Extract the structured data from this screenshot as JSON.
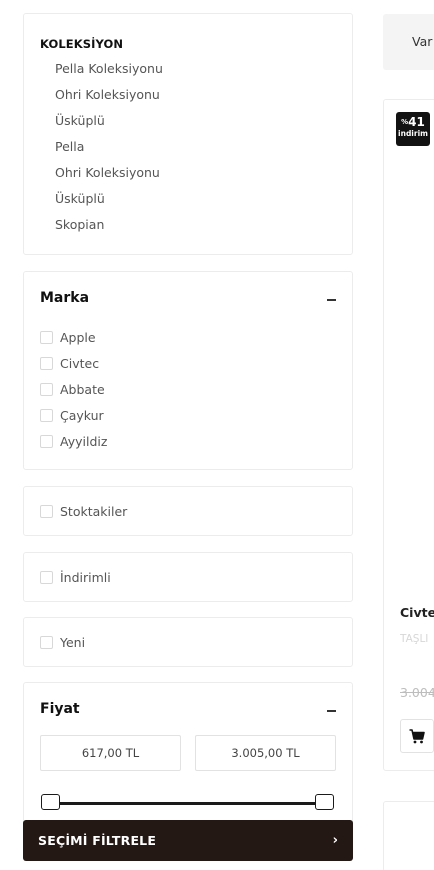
{
  "collection": {
    "title": "KOLEKSİYON",
    "items": [
      "Pella Koleksiyonu",
      "Ohri Koleksiyonu",
      "Üsküplü",
      "Pella",
      "Ohri Koleksiyonu",
      "Üsküplü",
      "Skopian"
    ]
  },
  "brand": {
    "title": "Marka",
    "items": [
      "Apple",
      "Civtec",
      "Abbate",
      "Çaykur",
      "Ayyildiz"
    ]
  },
  "stock": {
    "label": "Stoktakiler"
  },
  "discounted": {
    "label": "İndirimli"
  },
  "new_items": {
    "label": "Yeni"
  },
  "price": {
    "title": "Fiyat",
    "min": "617,00 TL",
    "max": "3.005,00 TL"
  },
  "filter_button": {
    "label": "SEÇİMİ FİLTRELE",
    "chevron": "›"
  },
  "sort": {
    "label": "Var"
  },
  "product": {
    "badge_pct": "41",
    "badge_pct_symbol": "%",
    "badge_label": "indirim",
    "brand": "Civte",
    "subtitle": "TAŞLI",
    "old_price": "3.004",
    "cart_icon": "cart-icon"
  },
  "colors": {
    "accent": "#241815",
    "badge": "#121212"
  }
}
